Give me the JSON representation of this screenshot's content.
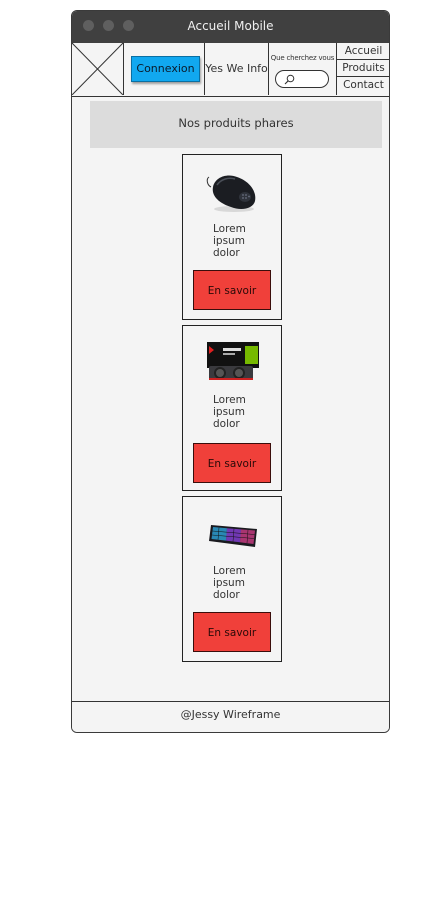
{
  "window": {
    "title": "Accueil Mobile"
  },
  "header": {
    "login_label": "Connexion",
    "brand": "Yes We Info",
    "search": {
      "label": "Que cherchez vous",
      "placeholder": ""
    },
    "nav": [
      {
        "label": "Accueil"
      },
      {
        "label": "Produits"
      },
      {
        "label": "Contact"
      }
    ]
  },
  "main": {
    "section_title": "Nos produits phares",
    "products": [
      {
        "image": "gaming-mouse-image",
        "text": "Lorem ipsum dolor sit",
        "button_label": "En savoir"
      },
      {
        "image": "graphics-card-image",
        "text": "Lorem ipsum dolor sit",
        "button_label": "En savoir"
      },
      {
        "image": "rgb-keyboard-image",
        "text": "Lorem ipsum dolor sit",
        "button_label": "En savoir"
      }
    ]
  },
  "footer": {
    "text": "@Jessy Wireframe"
  },
  "colors": {
    "login_button": "#11a8f0",
    "cta_button": "#f0403a",
    "titlebar": "#404040"
  }
}
